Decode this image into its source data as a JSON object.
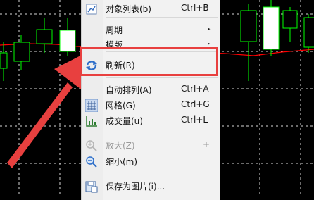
{
  "menu": {
    "items": [
      {
        "label": "对象列表(b)",
        "shortcut": "Ctrl+B",
        "icon": "object-list-icon"
      },
      {
        "label": "周期",
        "submenu": true
      },
      {
        "label": "模版",
        "submenu": true
      },
      {
        "label": "刷新(R)",
        "icon": "refresh-icon"
      },
      {
        "label": "自动排列(A)",
        "shortcut": "Ctrl+A"
      },
      {
        "label": "网格(G)",
        "shortcut": "Ctrl+G",
        "icon": "grid-icon"
      },
      {
        "label": "成交量(u)",
        "shortcut": "Ctrl+L",
        "icon": "volume-icon"
      },
      {
        "label": "放大(Z)",
        "shortcut": "+",
        "icon": "zoom-in-icon",
        "disabled": true
      },
      {
        "label": "缩小(m)",
        "shortcut": "-",
        "icon": "zoom-out-icon"
      },
      {
        "label": "保存为图片(i)...",
        "icon": "save-image-icon"
      }
    ],
    "submenu_arrow": "▸"
  },
  "colors": {
    "chart_background": "#000000",
    "grid": "#ffffff",
    "candles": "#00ff00",
    "moving_average": "#ff0000",
    "highlight": "#e8403f"
  }
}
